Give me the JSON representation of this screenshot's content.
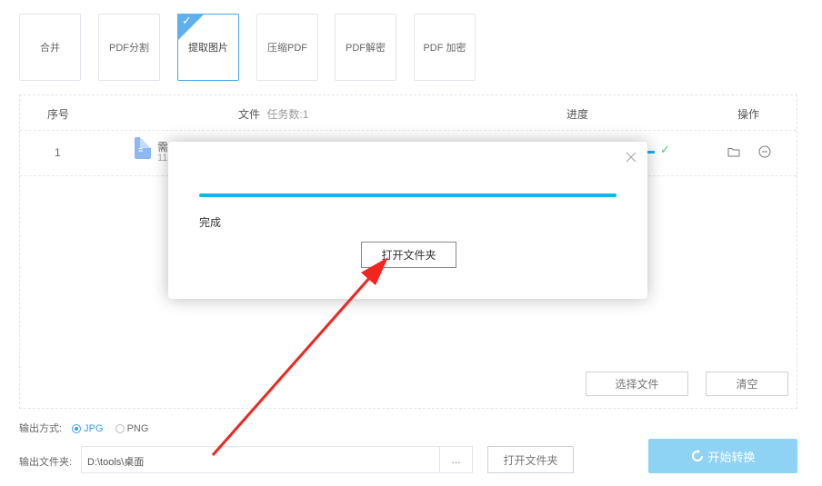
{
  "toolbar": {
    "tools": [
      {
        "label": "合并"
      },
      {
        "label": "PDF分割"
      },
      {
        "label": "提取图片",
        "active": true
      },
      {
        "label": "压缩PDF"
      },
      {
        "label": "PDF解密"
      },
      {
        "label": "PDF 加密"
      }
    ]
  },
  "table": {
    "headers": {
      "index": "序号",
      "file": "文件",
      "task_count": "任务数:1",
      "progress": "进度",
      "action": "操作"
    },
    "rows": [
      {
        "index": "1",
        "filename_partial": "需",
        "size_partial": "11"
      }
    ]
  },
  "panel_buttons": {
    "select_files": "选择文件",
    "clear": "清空"
  },
  "output": {
    "format_label": "输出方式:",
    "format_options": [
      "JPG",
      "PNG"
    ],
    "format_selected": "JPG",
    "folder_label": "输出文件夹:",
    "folder_value": "D:\\tools\\桌面",
    "browse": "...",
    "open_folder": "打开文件夹",
    "start": "开始转换"
  },
  "dialog": {
    "status": "完成",
    "progress": 1.0,
    "open_folder": "打开文件夹"
  },
  "colors": {
    "accent": "#17b2e8",
    "start_button": "#8fd3f4",
    "arrow": "#f2251f",
    "success": "#5cc36b"
  }
}
